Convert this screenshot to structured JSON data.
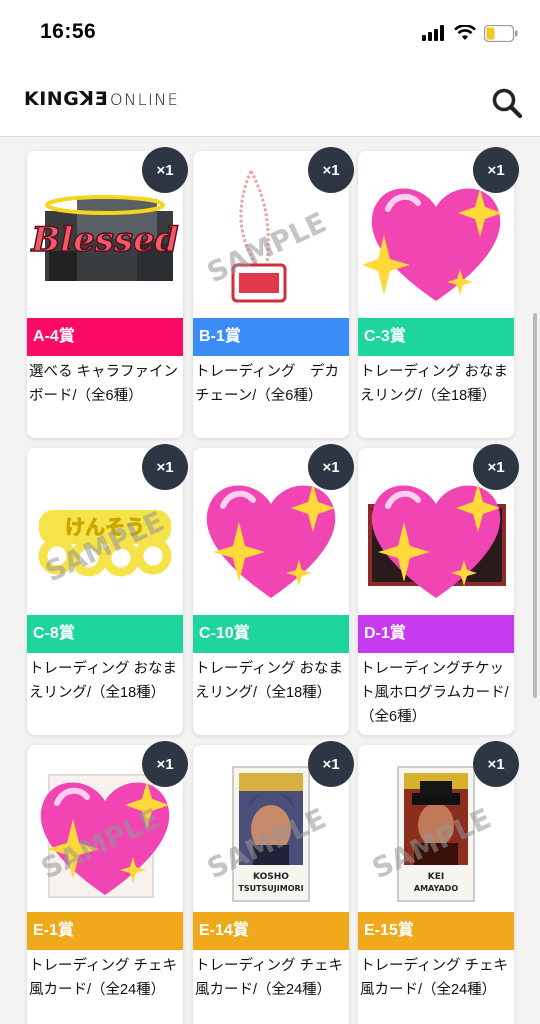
{
  "status": {
    "time": "16:56"
  },
  "header": {
    "logo_main": "KINGꓘƎ",
    "logo_sub": "ONLINE"
  },
  "colors": {
    "A": "#fb0b65",
    "B": "#3b8cf6",
    "C": "#1ed69d",
    "D": "#c83af2",
    "E": "#efa91a",
    "badge": "#2f3643"
  },
  "cards": [
    {
      "qty": "×1",
      "prize": "A-4賞",
      "title": "選べる キャラファインボード/（全6種）",
      "color": "#fb0b65"
    },
    {
      "qty": "×1",
      "prize": "B-1賞",
      "title": "トレーディング　デカチェーン/（全6種）",
      "color": "#3b8cf6"
    },
    {
      "qty": "×1",
      "prize": "C-3賞",
      "title": "トレーディング おなまえリング/（全18種）",
      "color": "#1ed69d"
    },
    {
      "qty": "×1",
      "prize": "C-8賞",
      "title": "トレーディング おなまえリング/（全18種）",
      "color": "#1ed69d"
    },
    {
      "qty": "×1",
      "prize": "C-10賞",
      "title": "トレーディング おなまえリング/（全18種）",
      "color": "#1ed69d"
    },
    {
      "qty": "×1",
      "prize": "D-1賞",
      "title": "トレーディングチケット風ホログラムカード/（全6種）",
      "color": "#c83af2"
    },
    {
      "qty": "×1",
      "prize": "E-1賞",
      "title": "トレーディング チェキ風カード/（全24種）",
      "color": "#efa91a"
    },
    {
      "qty": "×1",
      "prize": "E-14賞",
      "title": "トレーディング チェキ風カード/（全24種）",
      "color": "#efa91a"
    },
    {
      "qty": "×1",
      "prize": "E-15賞",
      "title": "トレーディング チェキ風カード/（全24種）",
      "color": "#efa91a"
    }
  ],
  "images": {
    "card_1_text": "Blessed",
    "sample_text": "SAMPLE",
    "card_4_text": "けんそう",
    "card_8_caption_1": "KOSHO",
    "card_8_caption_2": "TSUTSUJIMORI",
    "card_9_caption_1": "KEI",
    "card_9_caption_2": "AMAYADO"
  }
}
